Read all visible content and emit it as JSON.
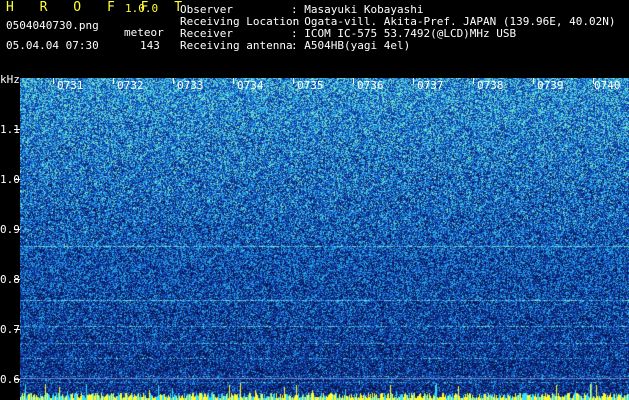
{
  "app": {
    "name": "H R O F F T",
    "version": "1.0.0"
  },
  "file": {
    "name": "0504040730.png",
    "datetime": "05.04.04 07:30"
  },
  "meteor": {
    "label": "meteor",
    "count": "143"
  },
  "info": [
    {
      "key": "Observer",
      "value": ": Masayuki Kobayashi"
    },
    {
      "key": "Receiving Location",
      "value": ": Ogata-vill. Akita-Pref. JAPAN (139.96E, 40.02N)"
    },
    {
      "key": "Receiver",
      "value": ": ICOM IC-575 53.7492(@LCD)MHz USB"
    },
    {
      "key": "Receiving antenna",
      "value": ": A504HB(yagi 4el)"
    }
  ],
  "yaxis": {
    "unit": "kHz",
    "ticks": [
      "1.1",
      "1.0",
      "0.9",
      "0.8",
      "0.7",
      "0.6"
    ],
    "tick_values": [
      1.1,
      1.0,
      0.9,
      0.8,
      0.7,
      0.6
    ]
  },
  "xaxis": {
    "ticks": [
      "0731",
      "0732",
      "0733",
      "0734",
      "0735",
      "0736",
      "0737",
      "0738",
      "0739",
      "0740"
    ]
  },
  "colors": {
    "text_yellow": "#ffff33",
    "background": "#000000",
    "spectrum_base": "#10307a"
  }
}
